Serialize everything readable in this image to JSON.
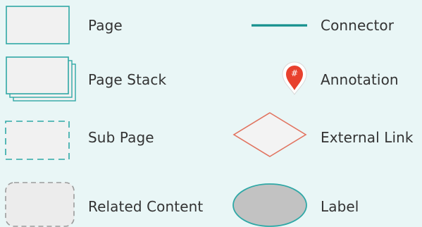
{
  "legend": {
    "items": [
      {
        "label": "Page",
        "icon": "page-icon"
      },
      {
        "label": "Page Stack",
        "icon": "page-stack-icon"
      },
      {
        "label": "Sub Page",
        "icon": "sub-page-icon"
      },
      {
        "label": "Related Content",
        "icon": "related-content-icon"
      },
      {
        "label": "Connector",
        "icon": "connector-icon"
      },
      {
        "label": "Annotation",
        "icon": "annotation-icon",
        "marker_text": "#"
      },
      {
        "label": "External Link",
        "icon": "external-link-icon"
      },
      {
        "label": "Label",
        "icon": "label-icon"
      }
    ]
  },
  "colors": {
    "background": "#e9f6f6",
    "page_border": "#2fa8a6",
    "page_fill": "#f1f1f1",
    "connector": "#16918e",
    "annotation": "#e8412e",
    "external_link": "#e1735f",
    "related_border": "#9b9b9b",
    "label_fill": "#c2c2c2",
    "label_border": "#2fa8a6"
  }
}
